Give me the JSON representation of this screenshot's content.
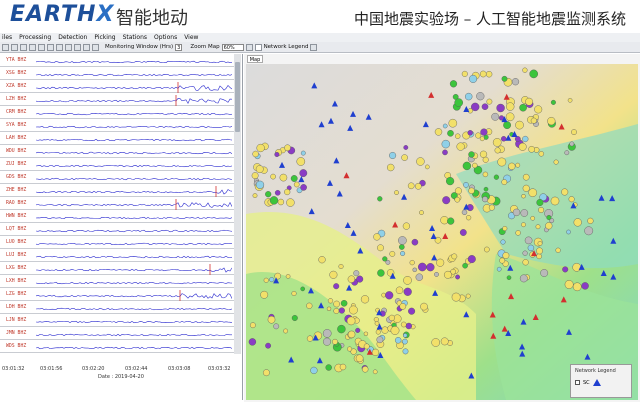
{
  "banner": {
    "logo_text": "EARTH",
    "logo_x": "X",
    "brand_cn": "智能地动",
    "title_cn": "中国地震实验场 – 人工智能地震监测系统"
  },
  "menu": [
    "iles",
    "Processing",
    "Detection",
    "Picking",
    "Stations",
    "Options",
    "View"
  ],
  "toolbar": {
    "monitoring_label": "Monitoring Window (Hrs)",
    "monitoring_value": "3",
    "zoom_label": "Zoom Map",
    "zoom_value": "60%",
    "network_legend_label": "Network Legend"
  },
  "traces": [
    "YTA BHZ",
    "XSG BHZ",
    "XZA BHZ",
    "LZH BHZ",
    "CRM BHZ",
    "SYA BHZ",
    "LAH BHZ",
    "WDU BHZ",
    "ZUJ BHZ",
    "GDS BHZ",
    "ZHE BHZ",
    "RAO BHZ",
    "HWN BHZ",
    "LQT BHZ",
    "LUO BHZ",
    "LUJ BHZ",
    "LXG BHZ",
    "LXH BHZ",
    "LZG BHZ",
    "LDH BHZ",
    "LJN BHZ",
    "JMN BHZ",
    "WDS BHZ"
  ],
  "time_axis": {
    "ticks": [
      "03:01:32",
      "03:01:56",
      "03:02:20",
      "03:02:44",
      "03:03:08",
      "03:03:32"
    ],
    "date": "Date : 2019-04-20"
  },
  "map": {
    "tab_label": "Map",
    "legend_title": "Network Legend",
    "legend_item": "SC"
  },
  "colors": {
    "logo_blue": "#1d4f9a",
    "trace_blue": "#2c2ccf",
    "pick_red": "#d32f2f",
    "station_blue": "#1f3fcf"
  }
}
